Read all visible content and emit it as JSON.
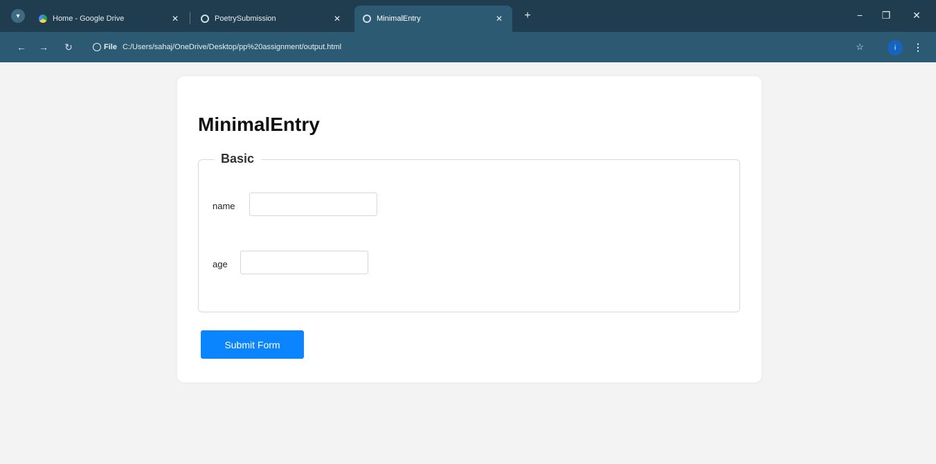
{
  "browser": {
    "tabs": [
      {
        "title": "Home - Google Drive",
        "active": false
      },
      {
        "title": "PoetrySubmission",
        "active": false
      },
      {
        "title": "MinimalEntry",
        "active": true
      }
    ],
    "address": {
      "scheme": "File",
      "url": "C:/Users/sahaj/OneDrive/Desktop/pp%20assignment/output.html"
    },
    "profile_initial": "i",
    "icons": {
      "tab_search": "chevron-down-icon",
      "new_tab": "plus-icon",
      "back": "arrow-left-icon",
      "forward": "arrow-right-icon",
      "reload": "reload-icon",
      "bookmark": "star-icon",
      "menu": "more-vertical-icon"
    }
  },
  "page": {
    "title": "MinimalEntry",
    "fieldset_legend": "Basic",
    "fields": [
      {
        "label": "name",
        "value": ""
      },
      {
        "label": "age",
        "value": ""
      }
    ],
    "submit_label": "Submit Form"
  },
  "colors": {
    "tabbar": "#1f3d4f",
    "toolbar": "#2c5a72",
    "accent_button": "#0b84ff",
    "page_background": "#f3f3f3"
  }
}
